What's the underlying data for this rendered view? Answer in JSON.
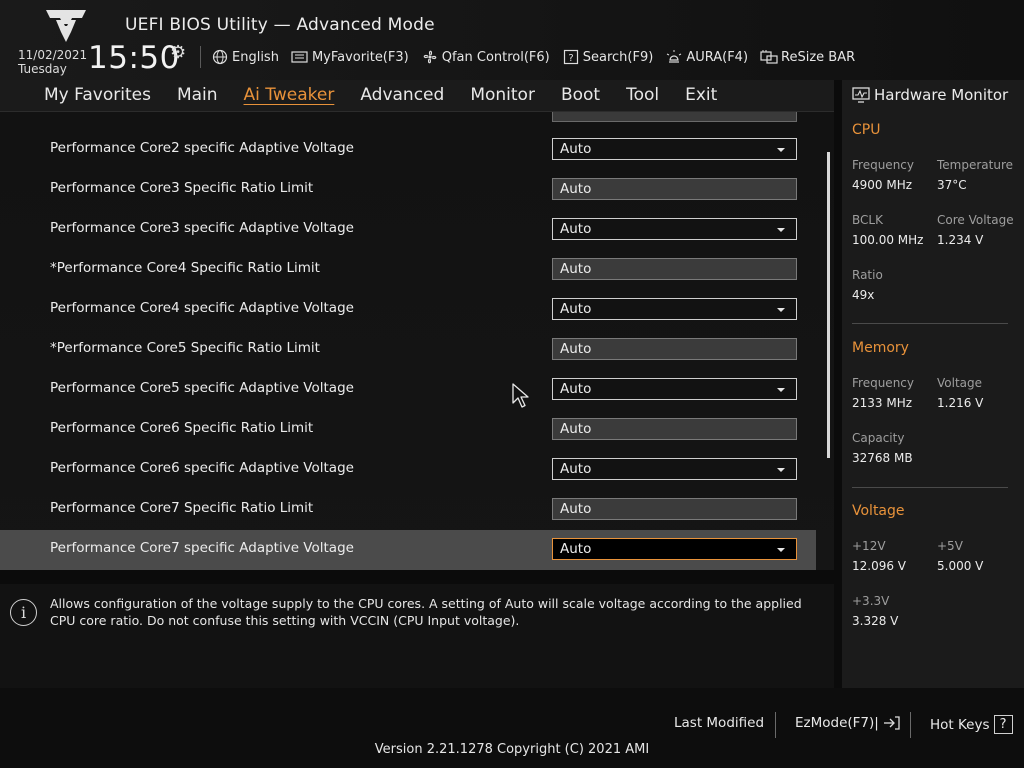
{
  "header": {
    "title": "UEFI BIOS Utility — Advanced Mode",
    "date": "11/02/2021",
    "day": "Tuesday",
    "time": "15:50",
    "toolbar": [
      {
        "icon": "globe-icon",
        "label": "English"
      },
      {
        "icon": "favorite-card-icon",
        "label": "MyFavorite(F3)"
      },
      {
        "icon": "fan-icon",
        "label": "Qfan Control(F6)"
      },
      {
        "icon": "search-question-icon",
        "label": "Search(F9)"
      },
      {
        "icon": "aura-lightbulb-icon",
        "label": "AURA(F4)"
      },
      {
        "icon": "resize-bar-icon",
        "label": "ReSize BAR"
      }
    ]
  },
  "menu": {
    "items": [
      "My Favorites",
      "Main",
      "Ai Tweaker",
      "Advanced",
      "Monitor",
      "Boot",
      "Tool",
      "Exit"
    ],
    "active": "Ai Tweaker"
  },
  "settings": [
    {
      "label": "Performance Core2 specific Adaptive Voltage",
      "value": "Auto",
      "type": "dropdown"
    },
    {
      "label": "Performance Core3 Specific Ratio Limit",
      "value": "Auto",
      "type": "text"
    },
    {
      "label": "Performance Core3 specific Adaptive Voltage",
      "value": "Auto",
      "type": "dropdown"
    },
    {
      "label": "*Performance Core4 Specific Ratio Limit",
      "value": "Auto",
      "type": "text"
    },
    {
      "label": "Performance Core4 specific Adaptive Voltage",
      "value": "Auto",
      "type": "dropdown"
    },
    {
      "label": "*Performance Core5 Specific Ratio Limit",
      "value": "Auto",
      "type": "text"
    },
    {
      "label": "Performance Core5 specific Adaptive Voltage",
      "value": "Auto",
      "type": "dropdown"
    },
    {
      "label": "Performance Core6 Specific Ratio Limit",
      "value": "Auto",
      "type": "text"
    },
    {
      "label": "Performance Core6 specific Adaptive Voltage",
      "value": "Auto",
      "type": "dropdown"
    },
    {
      "label": "Performance Core7 Specific Ratio Limit",
      "value": "Auto",
      "type": "text"
    },
    {
      "label": "Performance Core7 specific Adaptive Voltage",
      "value": "Auto",
      "type": "dropdown",
      "selected": true
    }
  ],
  "help": {
    "text": "Allows configuration of the voltage supply to the CPU cores. A setting of Auto will scale voltage according to the applied CPU core ratio.  Do not confuse this setting with VCCIN (CPU Input voltage)."
  },
  "hardware_monitor": {
    "title": "Hardware Monitor",
    "cpu": {
      "heading": "CPU",
      "frequency_label": "Frequency",
      "frequency": "4900 MHz",
      "temperature_label": "Temperature",
      "temperature": "37°C",
      "bclk_label": "BCLK",
      "bclk": "100.00 MHz",
      "core_voltage_label": "Core Voltage",
      "core_voltage": "1.234 V",
      "ratio_label": "Ratio",
      "ratio": "49x"
    },
    "memory": {
      "heading": "Memory",
      "frequency_label": "Frequency",
      "frequency": "2133 MHz",
      "voltage_label": "Voltage",
      "voltage": "1.216 V",
      "capacity_label": "Capacity",
      "capacity": "32768 MB"
    },
    "voltage": {
      "heading": "Voltage",
      "v12_label": "+12V",
      "v12": "12.096 V",
      "v5_label": "+5V",
      "v5": "5.000 V",
      "v33_label": "+3.3V",
      "v33": "3.328 V"
    }
  },
  "footer": {
    "last_modified": "Last Modified",
    "ezmode": "EzMode(F7)|",
    "hot_keys": "Hot Keys",
    "hot_keys_icon_text": "?",
    "version": "Version 2.21.1278 Copyright (C) 2021 AMI"
  },
  "colors": {
    "accent": "#e8923a",
    "background": "#0b0b0b",
    "panel": "#1b1b1b",
    "selected_row": "#4b4b4b"
  }
}
